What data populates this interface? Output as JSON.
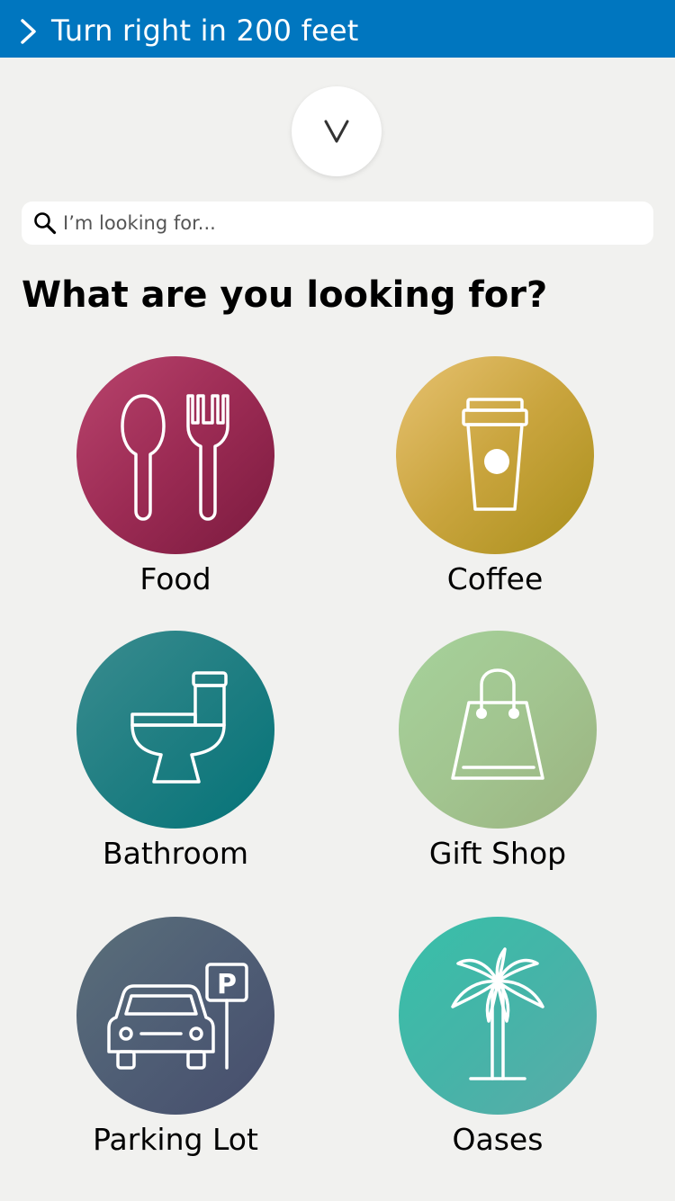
{
  "navigation": {
    "instruction": "Turn right in 200 feet",
    "arrow_icon": "chevron-right-icon",
    "color": "#0076bf"
  },
  "collapse_button": {
    "icon": "chevron-down-icon",
    "glyph": "V"
  },
  "search": {
    "placeholder": "I’m looking for...",
    "value": "",
    "icon": "search-icon"
  },
  "heading": "What are you looking for?",
  "categories": [
    {
      "label": "Food",
      "icon": "utensils-icon",
      "color": "#9c2b54"
    },
    {
      "label": "Coffee",
      "icon": "coffee-cup-icon",
      "color": "#c9a43d"
    },
    {
      "label": "Bathroom",
      "icon": "toilet-icon",
      "color": "#1f7e82"
    },
    {
      "label": "Gift Shop",
      "icon": "shopping-bag-icon",
      "color": "#a2c590"
    },
    {
      "label": "Parking Lot",
      "icon": "car-parking-icon",
      "color": "#4f5e75"
    },
    {
      "label": "Oases",
      "icon": "palm-tree-icon",
      "color": "#45b4a8"
    }
  ]
}
